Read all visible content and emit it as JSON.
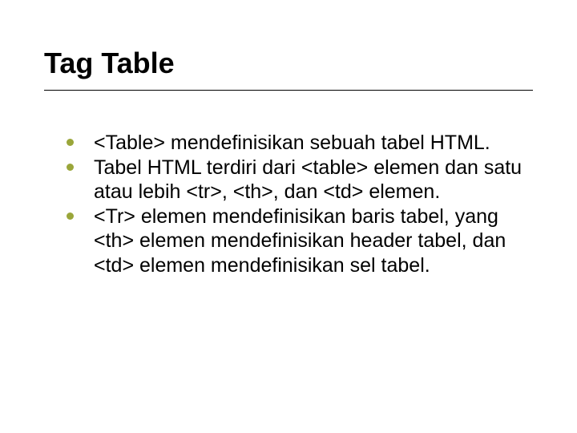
{
  "slide": {
    "title": "Tag Table",
    "bullets": [
      "<Table> mendefinisikan sebuah tabel HTML.",
      "Tabel HTML terdiri dari <table> elemen dan satu atau lebih <tr>, <th>, dan <td> elemen.",
      "<Tr> elemen mendefinisikan baris tabel, yang <th> elemen mendefinisikan header tabel, dan <td> elemen mendefinisikan sel tabel."
    ]
  }
}
